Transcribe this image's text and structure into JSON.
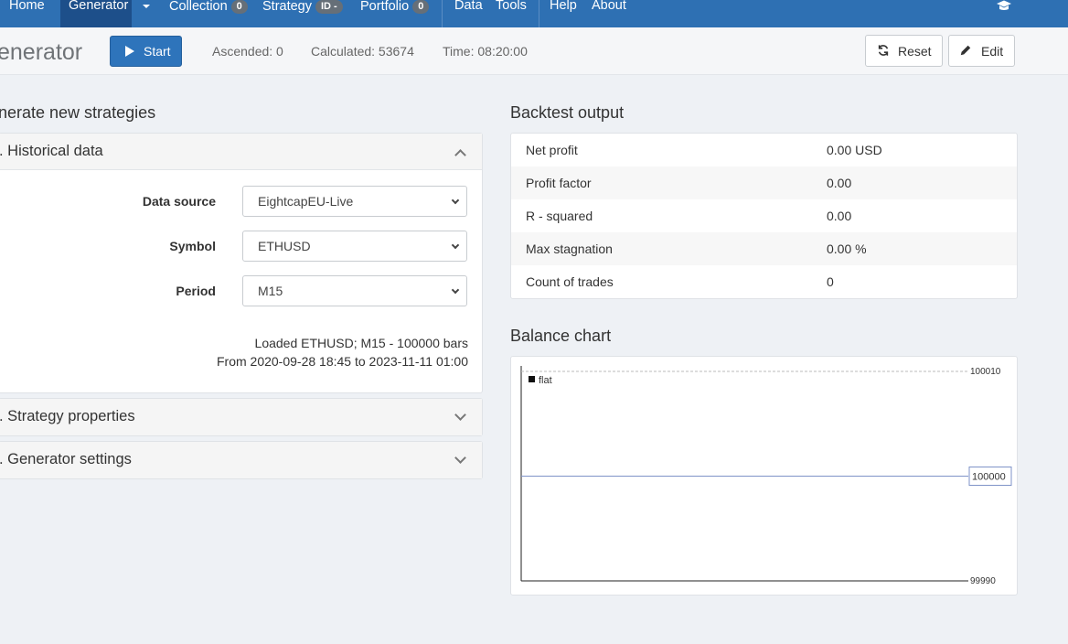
{
  "nav": {
    "home": "Home",
    "generator": "Generator",
    "collection": "Collection",
    "collection_count": "0",
    "strategy": "Strategy",
    "strategy_badge": "ID -",
    "portfolio": "Portfolio",
    "portfolio_count": "0",
    "data": "Data",
    "tools": "Tools",
    "help": "Help",
    "about": "About"
  },
  "toolbar": {
    "title": "enerator",
    "start_label": "Start",
    "ascended": "Ascended: 0",
    "calculated": "Calculated: 53674",
    "time": "Time: 08:20:00",
    "reset_label": "Reset",
    "edit_label": "Edit"
  },
  "left": {
    "heading": "nerate new strategies",
    "historical_title": ". Historical data",
    "data_source_label": "Data source",
    "data_source_value": "EightcapEU-Live",
    "symbol_label": "Symbol",
    "symbol_value": "ETHUSD",
    "period_label": "Period",
    "period_value": "M15",
    "loaded_info": "Loaded ETHUSD; M15 - 100000 bars",
    "range_info": "From 2020-09-28 18:45 to 2023-11-11 01:00",
    "strategy_props_title": ". Strategy properties",
    "generator_settings_title": ". Generator settings"
  },
  "backtest": {
    "heading": "Backtest output",
    "rows": [
      {
        "key": "Net profit",
        "value": "0.00 USD"
      },
      {
        "key": "Profit factor",
        "value": "0.00"
      },
      {
        "key": "R - squared",
        "value": "0.00"
      },
      {
        "key": "Max stagnation",
        "value": "0.00 %"
      },
      {
        "key": "Count of trades",
        "value": "0"
      }
    ]
  },
  "balance_chart": {
    "heading": "Balance chart",
    "chart_data": {
      "type": "line",
      "series": [
        {
          "name": "flat",
          "values": [
            100000,
            100000
          ]
        }
      ],
      "ylim": [
        99990,
        100010
      ],
      "y_ticks": [
        "100010",
        "99990"
      ],
      "current_value_label": "100000",
      "colors": {
        "series": "#7f93c8",
        "grid": "#bbbbbb"
      }
    }
  }
}
